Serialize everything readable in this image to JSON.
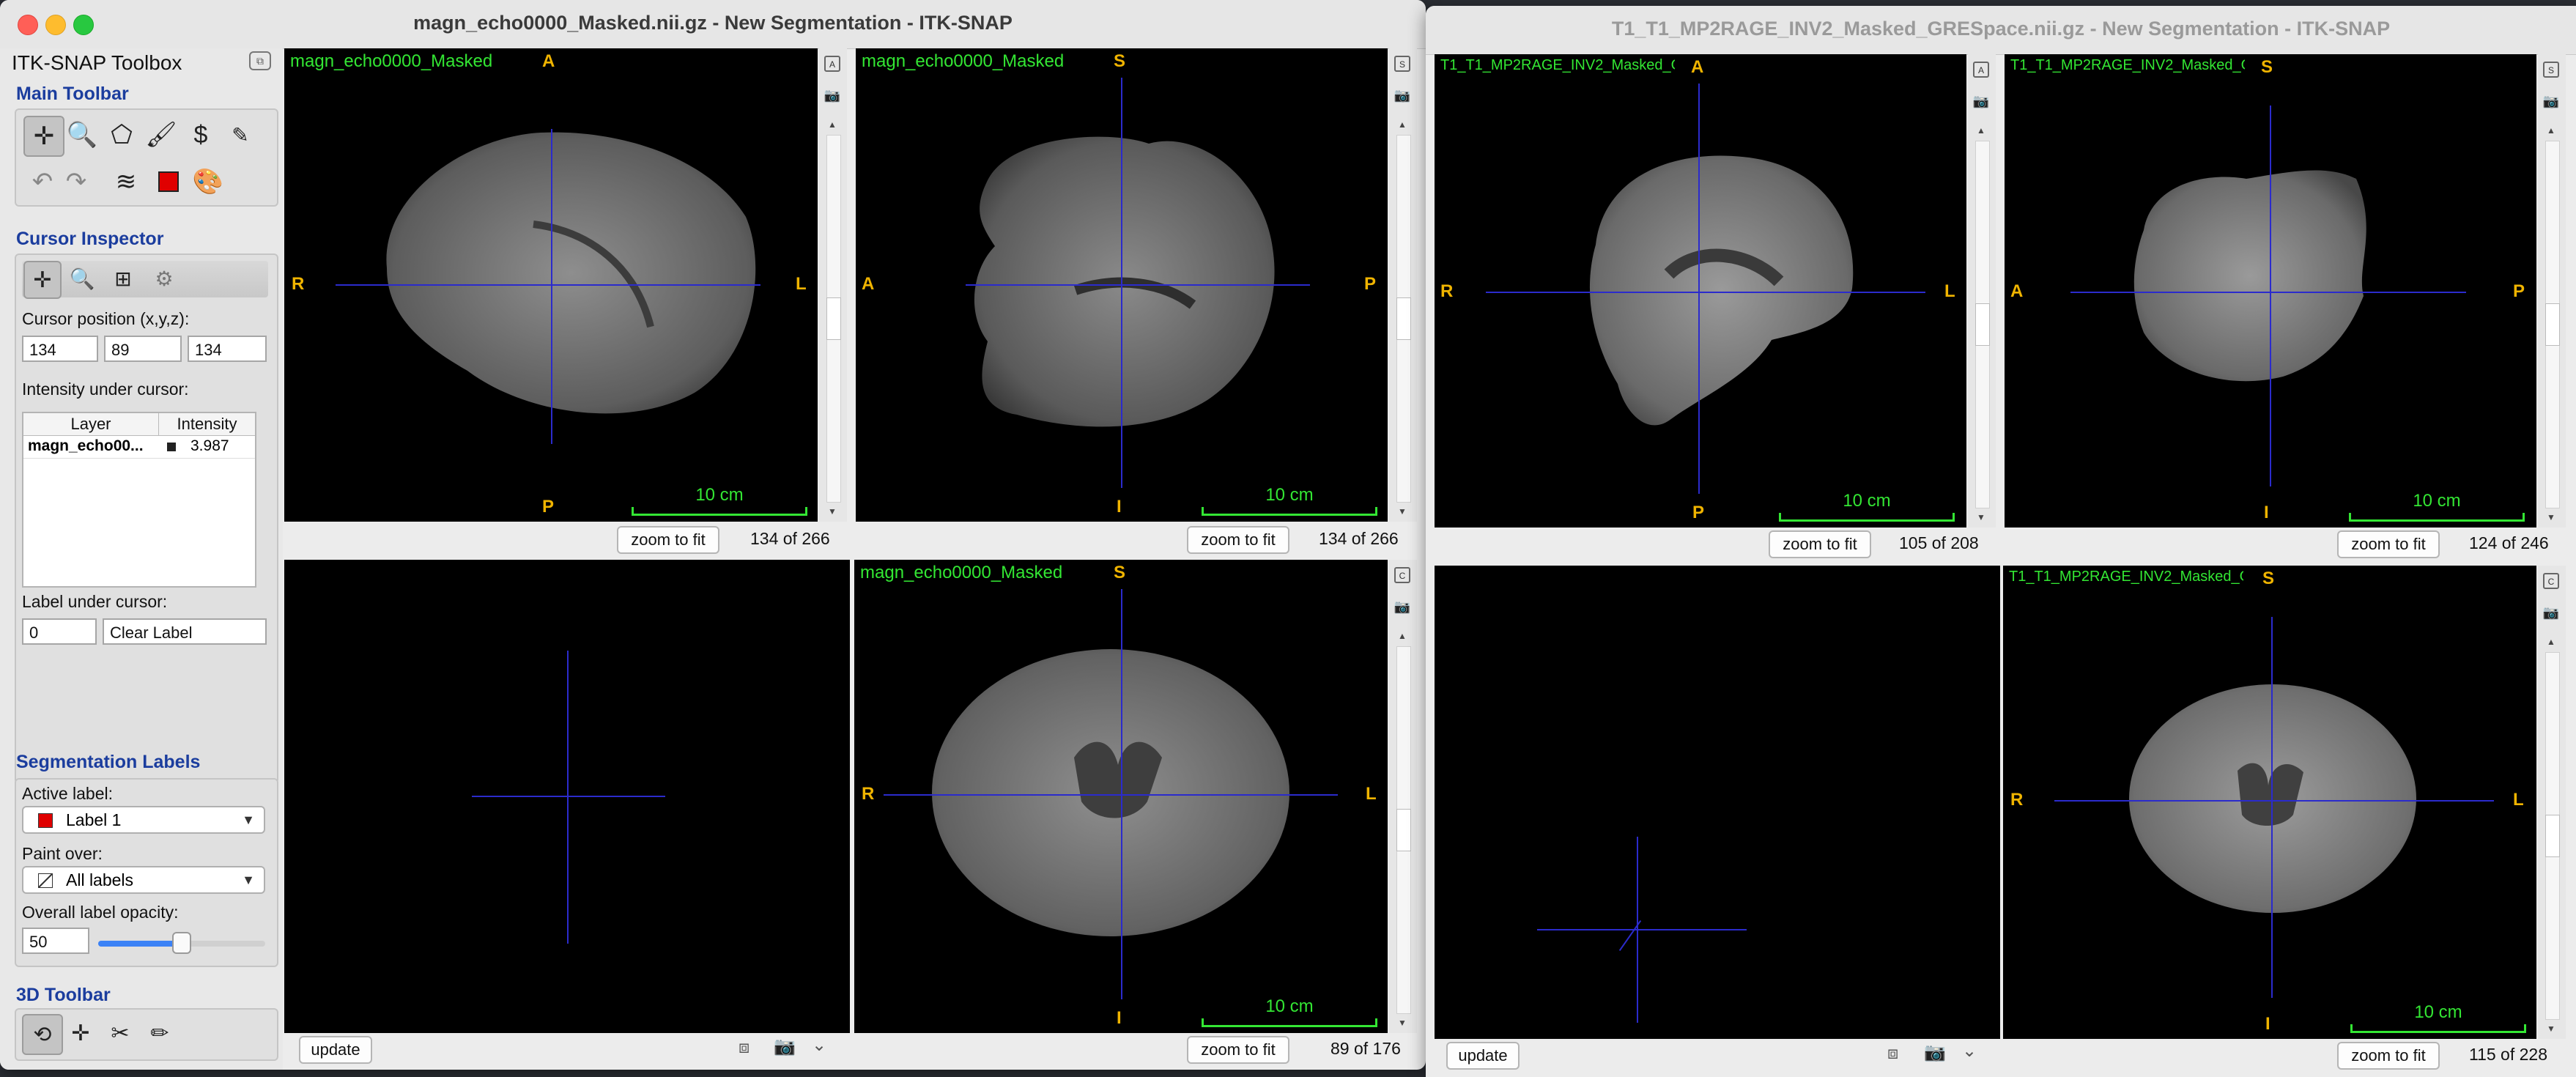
{
  "window_left": {
    "title": "magn_echo0000_Masked.nii.gz - New Segmentation - ITK-SNAP",
    "toolbox": {
      "title": "ITK-SNAP Toolbox",
      "main_toolbar": "Main Toolbar",
      "cursor_inspector": "Cursor Inspector",
      "cursor_position_label": "Cursor position (x,y,z):",
      "cursor_x": "134",
      "cursor_y": "89",
      "cursor_z": "134",
      "intensity_label": "Intensity under cursor:",
      "table_headers": [
        "Layer",
        "Intensity"
      ],
      "table_rows": [
        {
          "layer": "magn_echo00...",
          "intensity": "3.987"
        }
      ],
      "label_under_cursor": "Label under cursor:",
      "label_id": "0",
      "label_name": "Clear Label",
      "segmentation_labels": "Segmentation Labels",
      "active_label_caption": "Active label:",
      "active_label": "Label 1",
      "active_label_color": "#e00000",
      "paint_over_caption": "Paint over:",
      "paint_over": "All labels",
      "opacity_caption": "Overall label opacity:",
      "opacity_value": "50",
      "opacity_fraction": 0.5,
      "toolbar_3d": "3D Toolbar"
    },
    "views": [
      {
        "name": "magn_echo0000_Masked",
        "top": "A",
        "left": "R",
        "right": "L",
        "bottom": "P",
        "scale": "10 cm",
        "zoom": "zoom to fit",
        "slice": "134 of 266"
      },
      {
        "name": "magn_echo0000_Masked",
        "top": "S",
        "left": "A",
        "right": "P",
        "bottom": "I",
        "scale": "10 cm",
        "zoom": "zoom to fit",
        "slice": "134 of 266"
      },
      {
        "name": "magn_echo0000_Masked",
        "top": "S",
        "left": "R",
        "right": "L",
        "bottom": "I",
        "scale": "10 cm",
        "zoom": "zoom to fit",
        "slice": "89 of 176"
      }
    ],
    "update_button": "update"
  },
  "window_right": {
    "title": "T1_T1_MP2RAGE_INV2_Masked_GRESpace.nii.gz - New Segmentation - ITK-SNAP",
    "views": [
      {
        "name": "T1_T1_MP2RAGE_INV2_Masked_G...",
        "top": "A",
        "left": "R",
        "right": "L",
        "bottom": "P",
        "scale": "10 cm",
        "zoom": "zoom to fit",
        "slice": "105 of 208"
      },
      {
        "name": "T1_T1_MP2RAGE_INV2_Masked_G...",
        "top": "S",
        "left": "A",
        "right": "P",
        "bottom": "I",
        "scale": "10 cm",
        "zoom": "zoom to fit",
        "slice": "124 of 246"
      },
      {
        "name": "T1_T1_MP2RAGE_INV2_Masked_G...",
        "top": "S",
        "left": "R",
        "right": "L",
        "bottom": "I",
        "scale": "10 cm",
        "zoom": "zoom to fit",
        "slice": "115 of 228"
      }
    ],
    "update_button": "update"
  },
  "icons": [
    "close-dot",
    "minimize-dot",
    "zoom-dot",
    "crosshair-icon",
    "zoom-icon",
    "polygon-icon",
    "paintbrush-icon",
    "snake-icon",
    "annotation-icon",
    "undo-icon",
    "redo-icon",
    "layers-icon",
    "label-color-icon",
    "palette-icon",
    "camera-icon",
    "3d-icon",
    "chevron-down-icon"
  ]
}
